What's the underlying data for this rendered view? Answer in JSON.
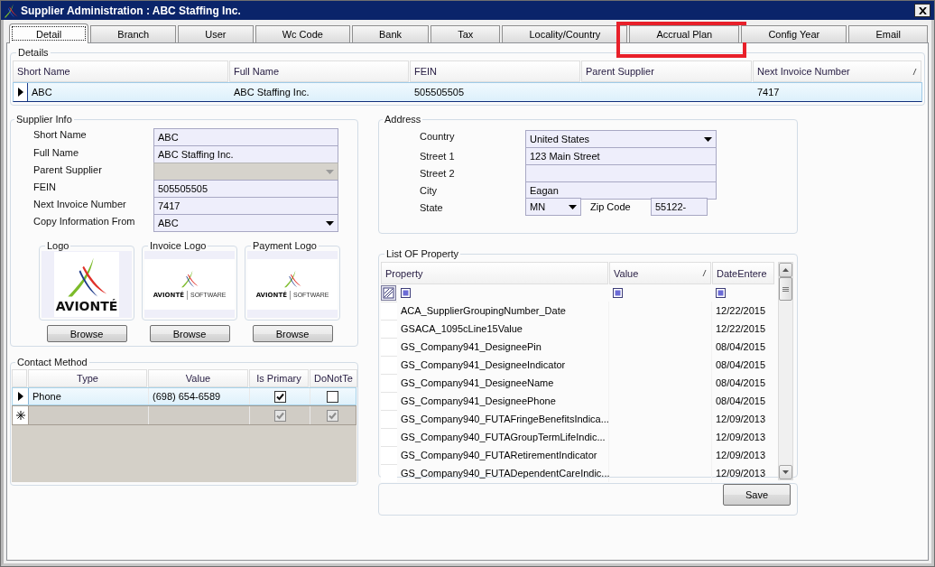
{
  "window": {
    "title": "Supplier Administration : ABC Staffing Inc."
  },
  "tabs": [
    {
      "label": "Detail",
      "selected": true,
      "highlighted": false
    },
    {
      "label": "Branch",
      "selected": false,
      "highlighted": false
    },
    {
      "label": "User",
      "selected": false,
      "highlighted": false
    },
    {
      "label": "Wc Code",
      "selected": false,
      "highlighted": false
    },
    {
      "label": "Bank",
      "selected": false,
      "highlighted": false
    },
    {
      "label": "Tax",
      "selected": false,
      "highlighted": false
    },
    {
      "label": "Locality/Country",
      "selected": false,
      "highlighted": false
    },
    {
      "label": "Accrual Plan",
      "selected": false,
      "highlighted": true
    },
    {
      "label": "Config Year",
      "selected": false,
      "highlighted": false
    },
    {
      "label": "Email",
      "selected": false,
      "highlighted": false
    }
  ],
  "details": {
    "title": "Details",
    "columns": [
      {
        "label": "Short Name",
        "sorted": false
      },
      {
        "label": "Full Name",
        "sorted": false
      },
      {
        "label": "FEIN",
        "sorted": false
      },
      {
        "label": "Parent Supplier",
        "sorted": false
      },
      {
        "label": "Next Invoice Number",
        "sorted": true
      }
    ],
    "rows": [
      {
        "short_name": "ABC",
        "full_name": "ABC Staffing Inc.",
        "fein": "505505505",
        "next_invoice_number": "7417",
        "selected": true
      }
    ]
  },
  "supplier_info": {
    "title": "Supplier Info",
    "fields": [
      {
        "label": "Short Name",
        "value": "ABC",
        "kind": "text",
        "disabled": false
      },
      {
        "label": "Full Name",
        "value": "ABC Staffing Inc.",
        "kind": "text",
        "disabled": false
      },
      {
        "label": "Parent Supplier",
        "kind": "dropdown",
        "disabled": true
      },
      {
        "label": "FEIN",
        "value": "505505505",
        "kind": "text",
        "disabled": false
      },
      {
        "label": "Next Invoice Number",
        "value": "7417",
        "kind": "text",
        "disabled": false
      },
      {
        "label": "Copy Information From",
        "value": "ABC",
        "kind": "dropdown",
        "disabled": false
      }
    ],
    "logos": [
      {
        "title": "Logo",
        "kind": "stacked",
        "wordmark": "AVIONTÉ",
        "button": "Browse"
      },
      {
        "title": "Invoice Logo",
        "kind": "wide",
        "wordmark": "AVIONTÉ",
        "tagline": "SOFTWARE",
        "button": "Browse"
      },
      {
        "title": "Payment Logo",
        "kind": "wide",
        "wordmark": "AVIONTÉ",
        "tagline": "SOFTWARE",
        "button": "Browse"
      }
    ]
  },
  "contact_method": {
    "title": "Contact Method",
    "columns": [
      "Type",
      "Value",
      "Is Primary",
      "DoNotTe"
    ],
    "rows": [
      {
        "kind": "data",
        "type": "Phone",
        "value": "(698) 654-6589",
        "is_primary": true,
        "do_not_te": false,
        "selected": true
      },
      {
        "kind": "new",
        "is_primary": true,
        "do_not_te": true,
        "selected": false
      }
    ]
  },
  "address": {
    "title": "Address",
    "fields": [
      {
        "label": "Country",
        "value": "United States",
        "kind": "dropdown"
      },
      {
        "label": "Street 1",
        "value": "123 Main Street",
        "kind": "text"
      },
      {
        "label": "Street 2",
        "kind": "text"
      },
      {
        "label": "City",
        "value": "Eagan",
        "kind": "text"
      }
    ],
    "state": {
      "label": "State",
      "value": "MN"
    },
    "zip_code": {
      "label": "Zip Code",
      "value": "55122-"
    }
  },
  "property_list": {
    "title": "List OF Property",
    "columns": [
      {
        "label": "Property",
        "sorted": false
      },
      {
        "label": "Value",
        "sorted": true
      },
      {
        "label": "DateEntere",
        "sorted": false
      }
    ],
    "rows": [
      {
        "property": "ACA_SupplierGroupingNumber_Date",
        "date_entere": "12/22/2015"
      },
      {
        "property": "GSACA_1095cLine15Value",
        "date_entere": "12/22/2015"
      },
      {
        "property": "GS_Company941_DesigneePin",
        "date_entere": "08/04/2015"
      },
      {
        "property": "GS_Company941_DesigneeIndicator",
        "date_entere": "08/04/2015"
      },
      {
        "property": "GS_Company941_DesigneeName",
        "date_entere": "08/04/2015"
      },
      {
        "property": "GS_Company941_DesigneePhone",
        "date_entere": "08/04/2015"
      },
      {
        "property": "GS_Company940_FUTAFringeBenefitsIndica...",
        "date_entere": "12/09/2013"
      },
      {
        "property": "GS_Company940_FUTAGroupTermLifeIndic...",
        "date_entere": "12/09/2013"
      },
      {
        "property": "GS_Company940_FUTARetirementIndicator",
        "date_entere": "12/09/2013"
      },
      {
        "property": "GS_Company940_FUTADependentCareIndic...",
        "date_entere": "12/09/2013"
      }
    ]
  },
  "footer": {
    "button": "Save"
  }
}
